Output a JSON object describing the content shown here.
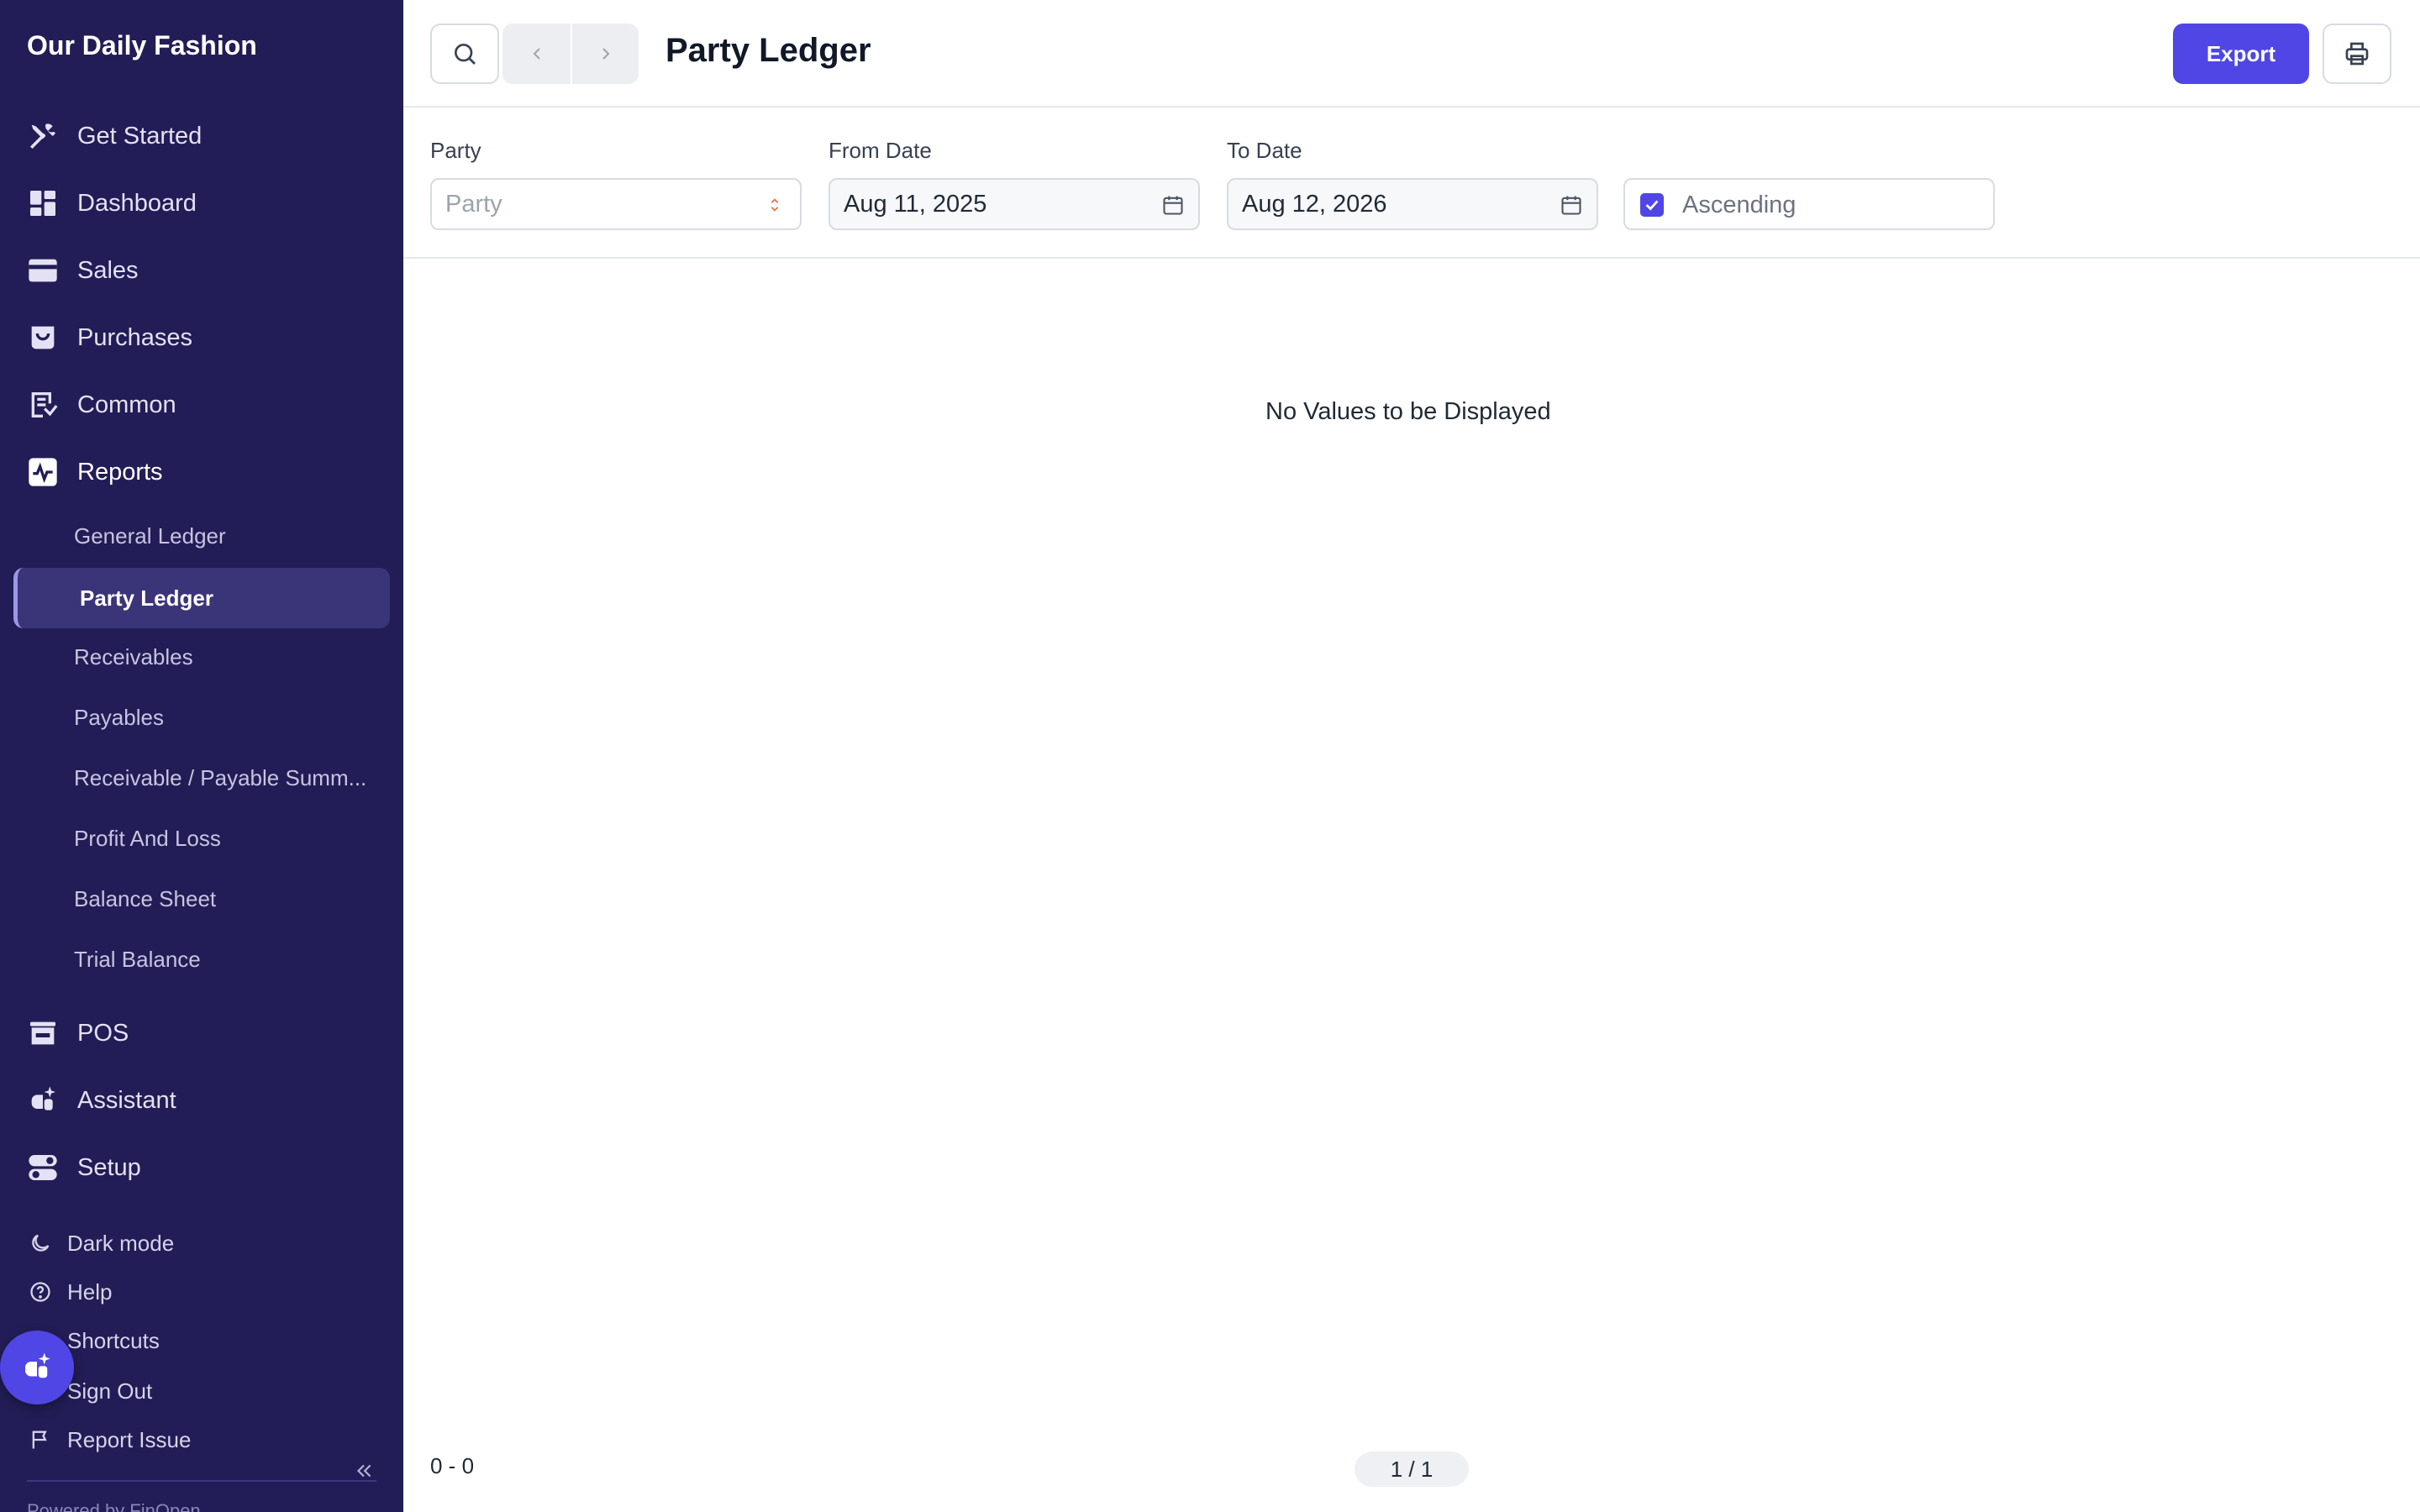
{
  "sidebar": {
    "brand": "Our Daily Fashion",
    "items": [
      {
        "label": "Get Started",
        "icon": "tools-icon"
      },
      {
        "label": "Dashboard",
        "icon": "dashboard-icon"
      },
      {
        "label": "Sales",
        "icon": "card-icon"
      },
      {
        "label": "Purchases",
        "icon": "bag-icon"
      },
      {
        "label": "Common",
        "icon": "list-icon"
      },
      {
        "label": "Reports",
        "icon": "activity-icon"
      },
      {
        "label": "POS",
        "icon": "store-icon"
      },
      {
        "label": "Assistant",
        "icon": "sparkle-icon"
      },
      {
        "label": "Setup",
        "icon": "toggle-icon"
      }
    ],
    "report_items": [
      "General Ledger",
      "Party Ledger",
      "Receivables",
      "Payables",
      "Receivable / Payable Summ...",
      "Profit And Loss",
      "Balance Sheet",
      "Trial Balance"
    ],
    "active_report": "Party Ledger",
    "footer": [
      {
        "label": "Dark mode",
        "icon": "moon-icon"
      },
      {
        "label": "Help",
        "icon": "help-icon"
      },
      {
        "label": "Shortcuts",
        "icon": "shortcuts-icon"
      },
      {
        "label": "Sign Out",
        "icon": "signout-icon"
      },
      {
        "label": "Report Issue",
        "icon": "flag-icon"
      }
    ],
    "powered_by": "Powered by FinOpen"
  },
  "header": {
    "title": "Party Ledger",
    "export_label": "Export"
  },
  "filters": {
    "party_label": "Party",
    "party_placeholder": "Party",
    "from_label": "From Date",
    "from_value": "Aug 11, 2025",
    "to_label": "To Date",
    "to_value": "Aug 12, 2026",
    "ascending_label": "Ascending",
    "ascending_checked": true
  },
  "content": {
    "empty_message": "No Values to be Displayed"
  },
  "footer": {
    "range": "0 - 0",
    "page": "1 / 1"
  },
  "colors": {
    "sidebar_bg": "#221d56",
    "accent": "#4f46e5",
    "active_item_bg": "#3a3478"
  }
}
